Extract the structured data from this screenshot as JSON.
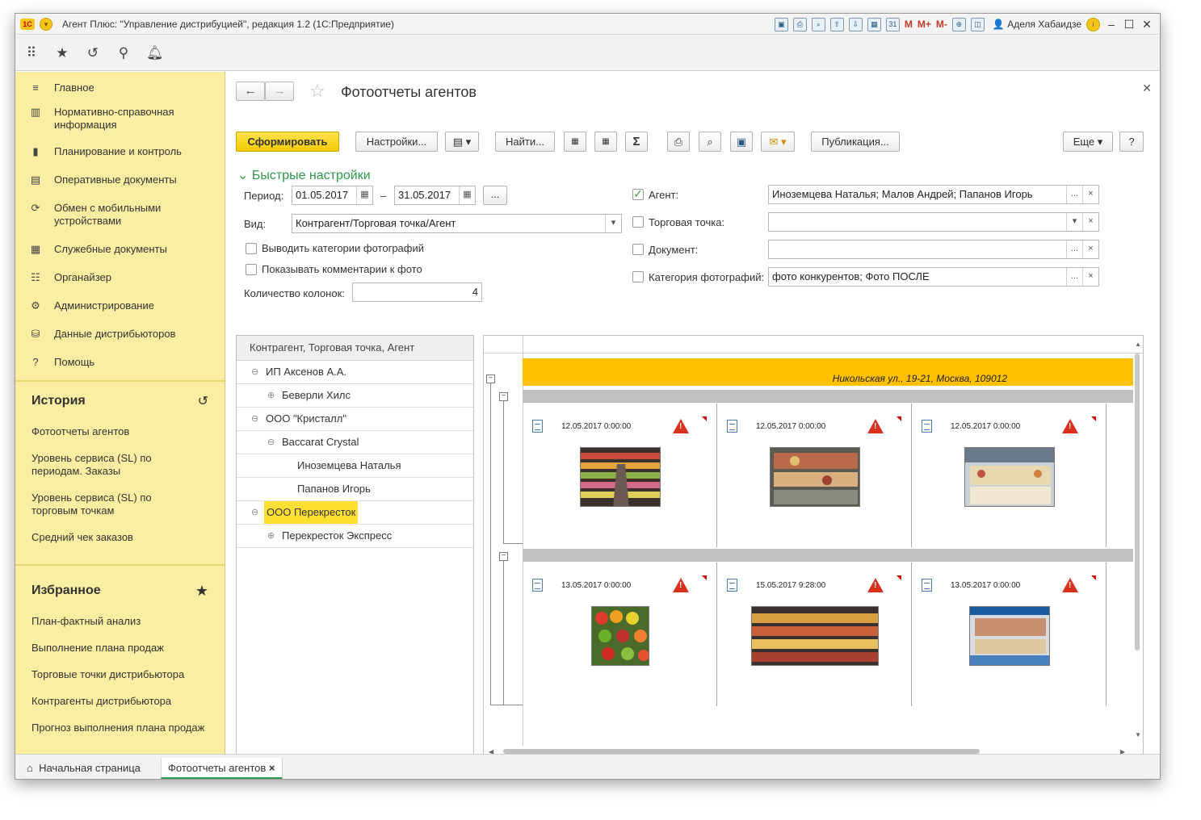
{
  "window": {
    "title": "Агент Плюс: \"Управление дистрибуцией\", редакция 1.2  (1С:Предприятие)",
    "user": "Аделя Хабаидзе",
    "tools": [
      "save-icon",
      "print-icon",
      "preview-icon",
      "upload-icon",
      "download-icon",
      "calculator-icon",
      "calendar-icon"
    ],
    "m_labels": [
      "M",
      "M+",
      "M-"
    ],
    "calendar_day": "31"
  },
  "sidebar": {
    "sections": [
      {
        "label": "Главное",
        "icon": "≡"
      },
      {
        "label": "Нормативно-справочная информация",
        "icon": "▥"
      },
      {
        "label": "Планирование и контроль",
        "icon": "▮"
      },
      {
        "label": "Оперативные документы",
        "icon": "▤"
      },
      {
        "label": "Обмен с мобильными устройствами",
        "icon": "⟳"
      },
      {
        "label": "Служебные документы",
        "icon": "▦"
      },
      {
        "label": "Органайзер",
        "icon": "☷"
      },
      {
        "label": "Администрирование",
        "icon": "⚙"
      },
      {
        "label": "Данные дистрибьюторов",
        "icon": "⛁"
      },
      {
        "label": "Помощь",
        "icon": "?"
      }
    ],
    "history": {
      "title": "История",
      "items": [
        "Фотоотчеты агентов",
        "Уровень сервиса (SL) по периодам. Заказы",
        "Уровень сервиса (SL) по торговым точкам",
        "Средний чек заказов"
      ]
    },
    "favorites": {
      "title": "Избранное",
      "items": [
        "План-фактный анализ",
        "Выполнение плана продаж",
        "Торговые точки дистрибьютора",
        "Контрагенты дистрибьютора",
        "Прогноз выполнения плана продаж"
      ]
    }
  },
  "form": {
    "title": "Фотоотчеты агентов",
    "toolbar": {
      "generate": "Сформировать",
      "settings": "Настройки...",
      "find": "Найти...",
      "sum": "Σ",
      "publish": "Публикация...",
      "more": "Еще",
      "help": "?"
    },
    "quick_settings": "Быстрые настройки",
    "period_label": "Период:",
    "period_from": "01.05.2017",
    "period_dash": "–",
    "period_to": "31.05.2017",
    "period_btn": "...",
    "view_label": "Вид:",
    "view_value": "Контрагент/Торговая точка/Агент",
    "show_categories": "Выводить категории фотографий",
    "show_comments": "Показывать комментарии к фото",
    "columns_label": "Количество колонок:",
    "columns_value": "4",
    "agent_label": "Агент:",
    "agent_value": "Иноземцева Наталья; Малов Андрей; Папанов Игорь",
    "outlet_label": "Торговая точка:",
    "outlet_value": "",
    "document_label": "Документ:",
    "document_value": "",
    "category_label": "Категория фотографий:",
    "category_value": "фото конкурентов; Фото ПОСЛЕ"
  },
  "tree": {
    "header": "Контрагент, Торговая точка, Агент",
    "rows": [
      {
        "label": "ИП Аксенов А.А.",
        "toggle": "⊖"
      },
      {
        "label": "Беверли Хилс",
        "toggle": "⊕"
      },
      {
        "label": "ООО \"Кристалл\"",
        "toggle": "⊖"
      },
      {
        "label": "Baccarat Crystal",
        "toggle": "⊖"
      },
      {
        "label": "Иноземцева Наталья",
        "toggle": ""
      },
      {
        "label": "Папанов Игорь",
        "toggle": ""
      },
      {
        "label": "ООО Перекресток",
        "toggle": "⊖"
      },
      {
        "label": "Перекресток Экспресс",
        "toggle": "⊕"
      }
    ]
  },
  "report": {
    "address": "Никольская ул., 19-21, Москва, 109012",
    "row1_dates": [
      "12.05.2017 0:00:00",
      "12.05.2017 0:00:00",
      "12.05.2017 0:00:00"
    ],
    "row2_dates": [
      "13.05.2017 0:00:00",
      "15.05.2017 9:28:00",
      "13.05.2017 0:00:00"
    ]
  },
  "tabs": {
    "home": "Начальная страница",
    "active": "Фотоотчеты агентов",
    "close": "×"
  }
}
